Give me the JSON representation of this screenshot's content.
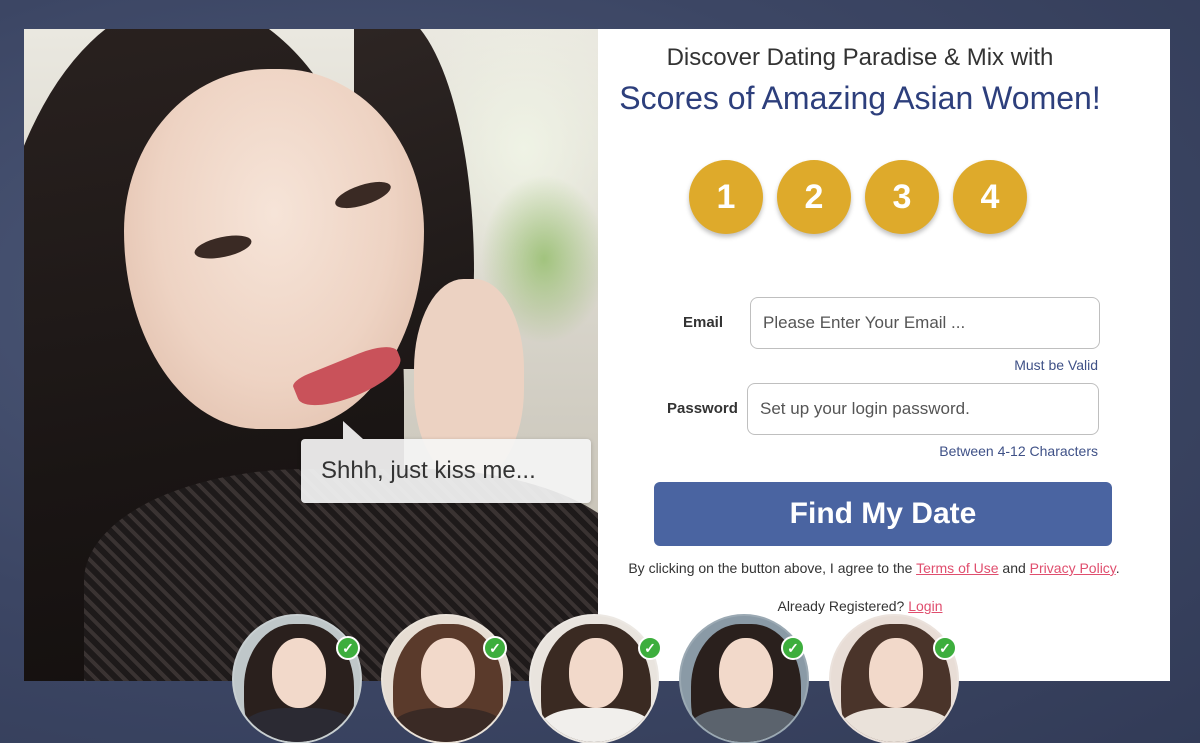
{
  "hero": {
    "speech_bubble": "Shhh, just kiss me..."
  },
  "headline": {
    "line1": "Discover Dating Paradise & Mix with",
    "line2": "Scores of Amazing Asian Women!"
  },
  "steps": [
    "1",
    "2",
    "3",
    "4"
  ],
  "form": {
    "email_label": "Email",
    "email_placeholder": "Please Enter Your Email ...",
    "email_value": "",
    "email_hint": "Must be Valid",
    "password_label": "Password",
    "password_placeholder": "Set up your login password.",
    "password_value": "",
    "password_hint": "Between 4-12 Characters",
    "submit_label": "Find My Date"
  },
  "legal": {
    "prefix": "By clicking on the button above, I agree to the",
    "terms_link": "Terms of Use",
    "conjunction": "and",
    "privacy_link": "Privacy Policy",
    "suffix": "."
  },
  "login": {
    "prompt": "Already Registered?",
    "link": "Login"
  },
  "members": {
    "count_shown": 5,
    "verified_icon": "check-icon"
  },
  "colors": {
    "brand_blue": "#2d3f7c",
    "button_blue": "#4a64a1",
    "step_gold": "#deaa2b",
    "link_pink": "#e04e6e",
    "verified_green": "#3dae3d",
    "backdrop": "#3c4664"
  }
}
